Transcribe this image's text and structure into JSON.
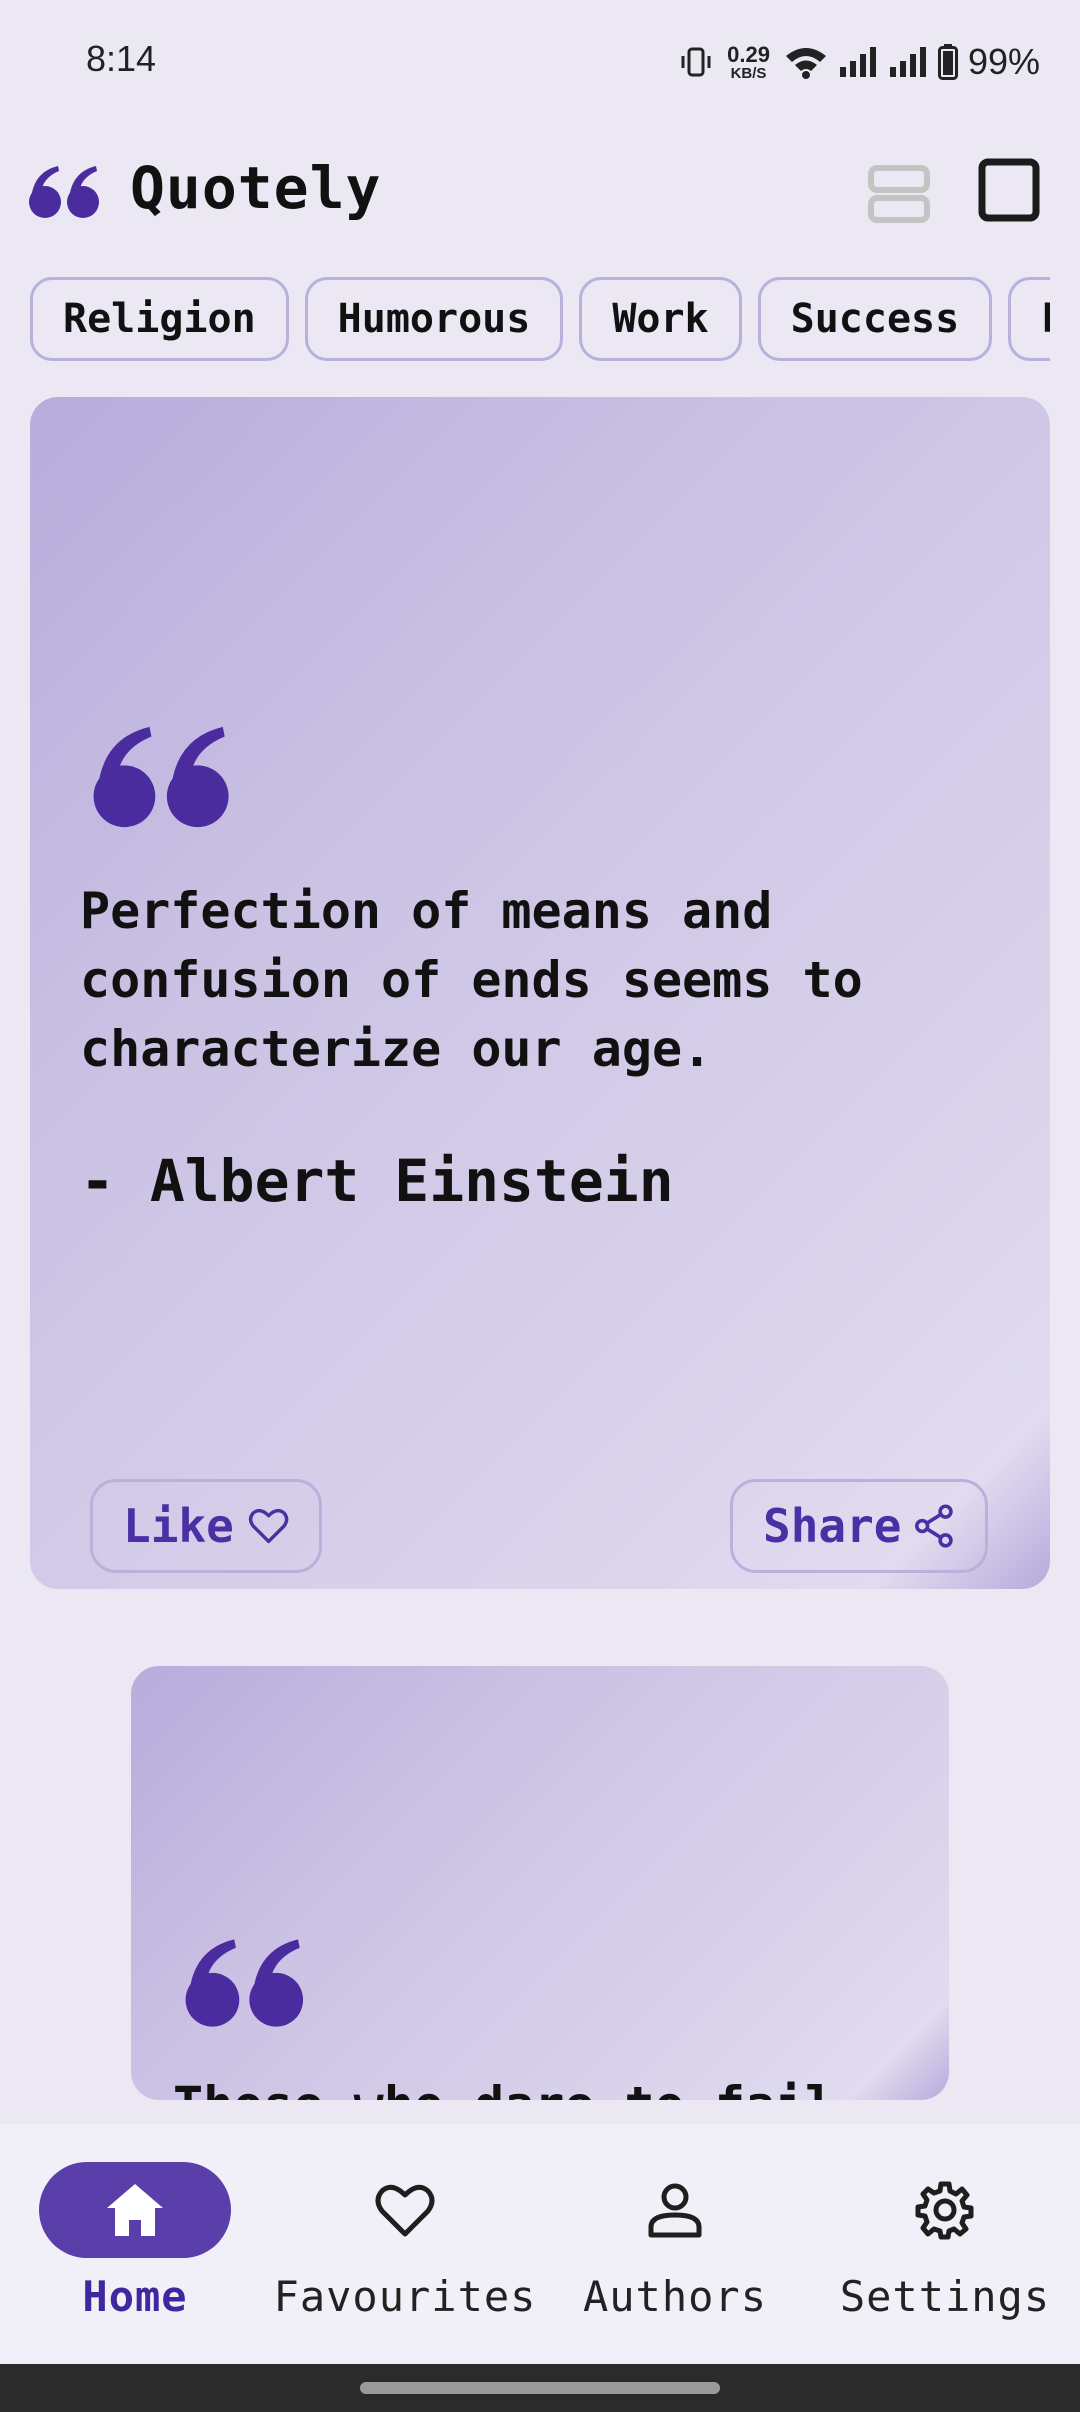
{
  "status_bar": {
    "time": "8:14",
    "net_speed_value": "0.29",
    "net_speed_unit": "KB/S",
    "battery": "99%"
  },
  "header": {
    "title": "Quotely",
    "logo_icon": "quote-icon"
  },
  "categories": [
    "Religion",
    "Humorous",
    "Work",
    "Success",
    "F"
  ],
  "quotes": [
    {
      "text": "Perfection of means and confusion of ends seems to characterize our age.",
      "author": "- Albert Einstein",
      "like_label": "Like",
      "share_label": "Share"
    },
    {
      "text": "Those who dare to fail"
    }
  ],
  "nav": {
    "items": [
      {
        "label": "Home",
        "icon": "home-icon",
        "active": true
      },
      {
        "label": "Favourites",
        "icon": "heart-icon"
      },
      {
        "label": "Authors",
        "icon": "person-icon"
      },
      {
        "label": "Settings",
        "icon": "gear-icon"
      }
    ]
  },
  "colors": {
    "accent": "#5a3ea9",
    "chip_border": "#b9b0dc",
    "background": "#ebe8f4"
  }
}
